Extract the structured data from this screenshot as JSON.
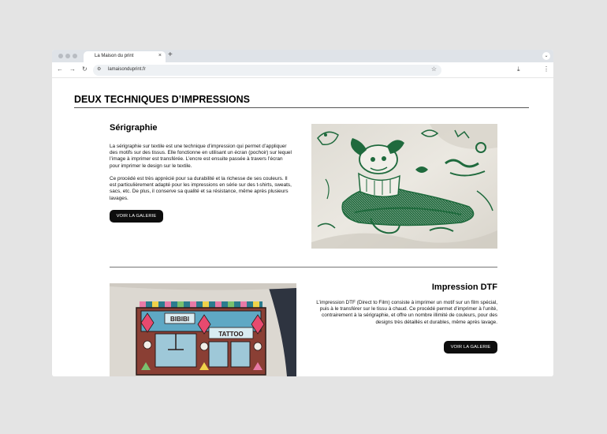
{
  "browser": {
    "tab_title": "La Maison du print",
    "tab_close": "×",
    "new_tab": "+",
    "url": "lamaisonduprint.fr"
  },
  "page": {
    "title": "DEUX TECHNIQUES D’IMPRESSIONS",
    "serigraphie": {
      "heading": "Sérigraphie",
      "paragraph1": "La sérigraphie sur textile est une technique d’impression qui permet d’appliquer des motifs sur des tissus. Elle fonctionne en utilisant un écran (pochoir) sur lequel l’image à imprimer est transférée. L’encre est ensuite passée à travers l’écran pour imprimer le design sur le textile.",
      "paragraph2": "Ce procédé est très apprécié pour sa durabilité et la richesse de ses couleurs. Il est particulièrement adapté pour les impressions en série sur des t-shirts, sweats, sacs, etc. De plus, il conserve sa qualité et sa résistance, même après plusieurs lavages.",
      "button": "VOIR LA GALERIE"
    },
    "dtf": {
      "heading": "Impression DTF",
      "paragraph": "L’impression DTF (Direct to Film) consiste à imprimer un motif sur un film spécial, puis à le transférer sur le tissu à chaud. Ce procédé permet d’imprimer à l’unité, contrairement à la sérigraphie, et offre un nombre illimité de couleurs, pour des designs très détaillés et durables, même après lavage.",
      "button": "VOIR LA GALERIE",
      "shop_sign_left": "BIBIBI",
      "shop_sign_right": "TATTOO"
    }
  },
  "colors": {
    "ink_green": "#1f6a3d",
    "fabric": "#e7e4dd",
    "button": "#0d0d0d"
  }
}
